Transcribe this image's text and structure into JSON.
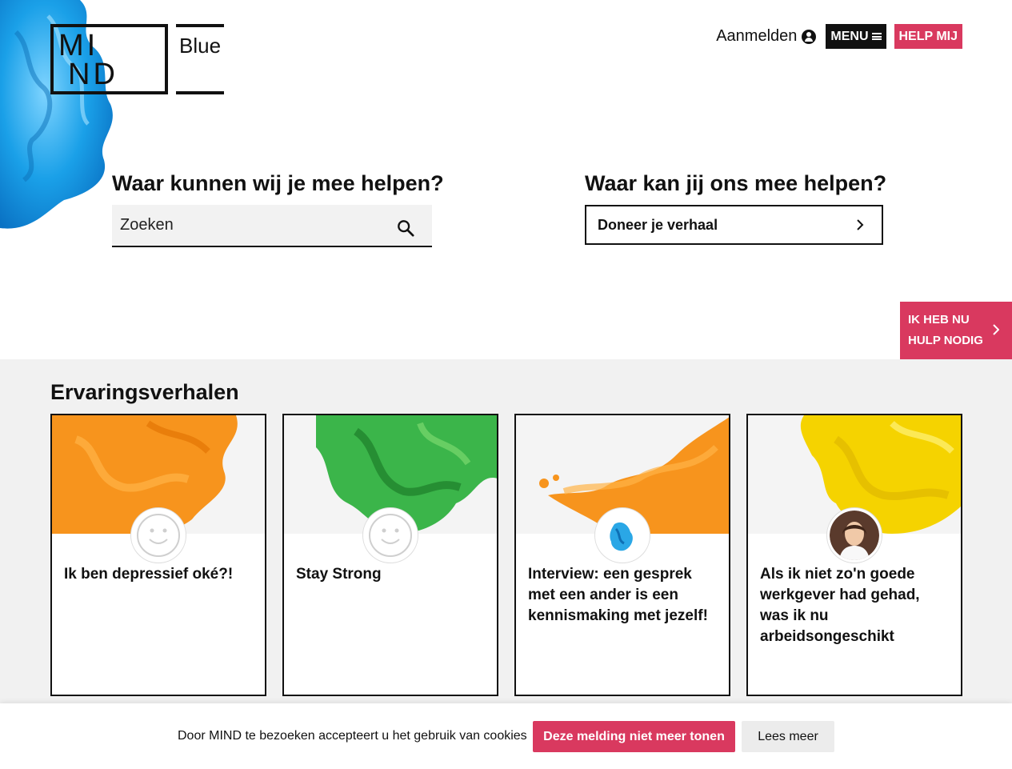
{
  "header": {
    "logo_line1": "MI",
    "logo_line2": "ND",
    "logo_sub": "Blue",
    "login_label": "Aanmelden",
    "menu_label": "MENU",
    "help_label": "HELP MIJ"
  },
  "help_us": {
    "left_heading": "Waar kunnen wij je mee helpen?",
    "search_placeholder": "Zoeken",
    "right_heading": "Waar kan jij ons mee helpen?",
    "donate_label": "Doneer je verhaal"
  },
  "side_help": {
    "line1": "IK HEB NU",
    "line2": "HULP NODIG"
  },
  "stories": {
    "title": "Ervaringsverhalen",
    "cards": [
      {
        "title": "Ik ben depressief oké?!",
        "image": "orange-ink",
        "avatar": "smiley-icon"
      },
      {
        "title": "Stay Strong",
        "image": "green-ink",
        "avatar": "smiley-icon"
      },
      {
        "title": "Interview: een gesprek met een ander is een kennismaking met jezelf!",
        "image": "orange-ink-splash",
        "avatar": "blue-ink-avatar"
      },
      {
        "title": "Als ik niet zo'n goede werkgever had gehad, was ik nu arbeidsongeschikt",
        "image": "yellow-ink",
        "avatar": "person-photo"
      }
    ]
  },
  "cookie": {
    "text": "Door MIND te bezoeken accepteert u het gebruik van cookies",
    "accept_label": "Deze melding niet meer tonen",
    "more_label": "Lees meer"
  },
  "colors": {
    "brand_pink": "#d9395f",
    "dark": "#111111",
    "section_bg": "#f1f1f1"
  }
}
